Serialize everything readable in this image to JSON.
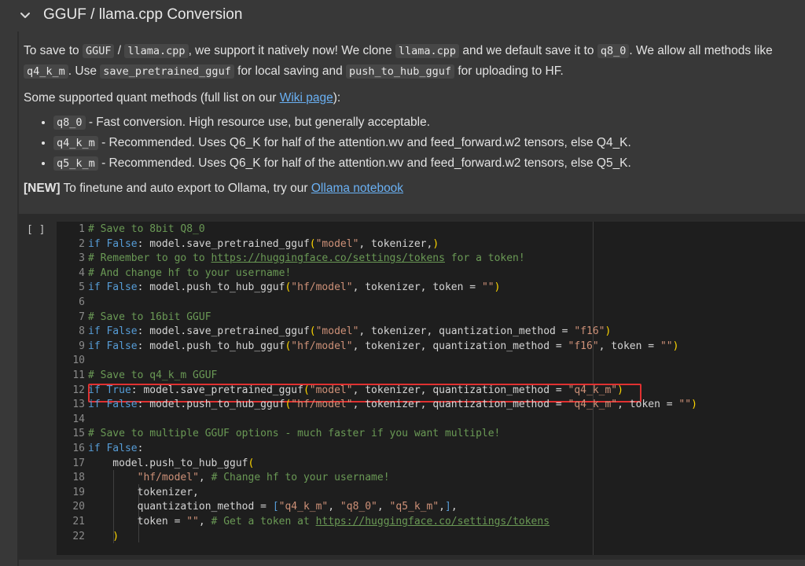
{
  "header": {
    "title": "GGUF / llama.cpp Conversion"
  },
  "intro": {
    "t1": "To save to ",
    "c1": "GGUF",
    "t2": " / ",
    "c2": "llama.cpp",
    "t3": ", we support it natively now! We clone ",
    "c3": "llama.cpp",
    "t4": " and we default save it to ",
    "c4": "q8_0",
    "t5": ". We allow all methods like ",
    "c5": "q4_k_m",
    "t6": ". Use ",
    "c6": "save_pretrained_gguf",
    "t7": " for local saving and ",
    "c7": "push_to_hub_gguf",
    "t8": " for uploading to HF."
  },
  "quant_intro": {
    "before": "Some supported quant methods (full list on our ",
    "link": "Wiki page",
    "after": "):"
  },
  "quant_list": [
    {
      "code": "q8_0",
      "desc": " - Fast conversion. High resource use, but generally acceptable."
    },
    {
      "code": "q4_k_m",
      "desc": " - Recommended. Uses Q6_K for half of the attention.wv and feed_forward.w2 tensors, else Q4_K."
    },
    {
      "code": "q5_k_m",
      "desc": " - Recommended. Uses Q6_K for half of the attention.wv and feed_forward.w2 tensors, else Q5_K."
    }
  ],
  "new_note": {
    "tag": "[NEW]",
    "text": " To finetune and auto export to Ollama, try our ",
    "link": "Ollama notebook"
  },
  "cell": {
    "run_label": "[ ]"
  },
  "code_lines": [
    {
      "n": "1",
      "toks": [
        [
          "c",
          "# Save to 8bit Q8_0"
        ]
      ]
    },
    {
      "n": "2",
      "toks": [
        [
          "k",
          "if"
        ],
        [
          "d",
          " "
        ],
        [
          "k",
          "False"
        ],
        [
          "d",
          ": model.save_pretrained_gguf"
        ],
        [
          "p",
          "("
        ],
        [
          "s",
          "\"model\""
        ],
        [
          "d",
          ", tokenizer,"
        ],
        [
          "p",
          ")"
        ]
      ]
    },
    {
      "n": "3",
      "toks": [
        [
          "c",
          "# Remember to go to "
        ],
        [
          "cu",
          "https://huggingface.co/settings/tokens"
        ],
        [
          "c",
          " for a token!"
        ]
      ]
    },
    {
      "n": "4",
      "toks": [
        [
          "c",
          "# And change hf to your username!"
        ]
      ]
    },
    {
      "n": "5",
      "toks": [
        [
          "k",
          "if"
        ],
        [
          "d",
          " "
        ],
        [
          "k",
          "False"
        ],
        [
          "d",
          ": model.push_to_hub_gguf"
        ],
        [
          "p",
          "("
        ],
        [
          "s",
          "\"hf/model\""
        ],
        [
          "d",
          ", tokenizer, token = "
        ],
        [
          "s",
          "\"\""
        ],
        [
          "p",
          ")"
        ]
      ]
    },
    {
      "n": "6",
      "toks": []
    },
    {
      "n": "7",
      "toks": [
        [
          "c",
          "# Save to 16bit GGUF"
        ]
      ]
    },
    {
      "n": "8",
      "toks": [
        [
          "k",
          "if"
        ],
        [
          "d",
          " "
        ],
        [
          "k",
          "False"
        ],
        [
          "d",
          ": model.save_pretrained_gguf"
        ],
        [
          "p",
          "("
        ],
        [
          "s",
          "\"model\""
        ],
        [
          "d",
          ", tokenizer, quantization_method = "
        ],
        [
          "s",
          "\"f16\""
        ],
        [
          "p",
          ")"
        ]
      ]
    },
    {
      "n": "9",
      "toks": [
        [
          "k",
          "if"
        ],
        [
          "d",
          " "
        ],
        [
          "k",
          "False"
        ],
        [
          "d",
          ": model.push_to_hub_gguf"
        ],
        [
          "p",
          "("
        ],
        [
          "s",
          "\"hf/model\""
        ],
        [
          "d",
          ", tokenizer, quantization_method = "
        ],
        [
          "s",
          "\"f16\""
        ],
        [
          "d",
          ", token = "
        ],
        [
          "s",
          "\"\""
        ],
        [
          "p",
          ")"
        ]
      ]
    },
    {
      "n": "10",
      "toks": []
    },
    {
      "n": "11",
      "toks": [
        [
          "c",
          "# Save to q4_k_m GGUF"
        ]
      ]
    },
    {
      "n": "12",
      "toks": [
        [
          "k",
          "if"
        ],
        [
          "d",
          " "
        ],
        [
          "k",
          "True"
        ],
        [
          "d",
          ": model.save_pretrained_gguf"
        ],
        [
          "p",
          "("
        ],
        [
          "s",
          "\"model\""
        ],
        [
          "d",
          ", tokenizer, quantization_method = "
        ],
        [
          "s",
          "\"q4_k_m\""
        ],
        [
          "p",
          ")"
        ]
      ]
    },
    {
      "n": "13",
      "toks": [
        [
          "k",
          "if"
        ],
        [
          "d",
          " "
        ],
        [
          "k",
          "False"
        ],
        [
          "d",
          ": model.push_to_hub_gguf"
        ],
        [
          "p",
          "("
        ],
        [
          "s",
          "\"hf/model\""
        ],
        [
          "d",
          ", tokenizer, quantization_method = "
        ],
        [
          "s",
          "\"q4_k_m\""
        ],
        [
          "d",
          ", token = "
        ],
        [
          "s",
          "\"\""
        ],
        [
          "p",
          ")"
        ]
      ]
    },
    {
      "n": "14",
      "toks": []
    },
    {
      "n": "15",
      "toks": [
        [
          "c",
          "# Save to multiple GGUF options - much faster if you want multiple!"
        ]
      ]
    },
    {
      "n": "16",
      "toks": [
        [
          "k",
          "if"
        ],
        [
          "d",
          " "
        ],
        [
          "k",
          "False"
        ],
        [
          "d",
          ":"
        ]
      ]
    },
    {
      "n": "17",
      "toks": [
        [
          "d",
          "    model.push_to_hub_gguf"
        ],
        [
          "p",
          "("
        ]
      ]
    },
    {
      "n": "18",
      "toks": [
        [
          "d",
          "        "
        ],
        [
          "s",
          "\"hf/model\""
        ],
        [
          "d",
          ", "
        ],
        [
          "c",
          "# Change hf to your username!"
        ]
      ]
    },
    {
      "n": "19",
      "toks": [
        [
          "d",
          "        tokenizer,"
        ]
      ]
    },
    {
      "n": "20",
      "toks": [
        [
          "d",
          "        quantization_method = "
        ],
        [
          "k",
          "["
        ],
        [
          "s",
          "\"q4_k_m\""
        ],
        [
          "d",
          ", "
        ],
        [
          "s",
          "\"q8_0\""
        ],
        [
          "d",
          ", "
        ],
        [
          "s",
          "\"q5_k_m\""
        ],
        [
          "d",
          ","
        ],
        [
          "k",
          "]"
        ],
        [
          "d",
          ","
        ]
      ]
    },
    {
      "n": "21",
      "toks": [
        [
          "d",
          "        token = "
        ],
        [
          "s",
          "\"\""
        ],
        [
          "d",
          ", "
        ],
        [
          "c",
          "# Get a token at "
        ],
        [
          "cu",
          "https://huggingface.co/settings/tokens"
        ]
      ]
    },
    {
      "n": "22",
      "toks": [
        [
          "p",
          "    )"
        ]
      ]
    }
  ],
  "colors": {
    "comment": "#6a9955",
    "keyword": "#569cd6",
    "string": "#ce9178",
    "paren": "#ffd700",
    "highlight_box": "#e03131",
    "link": "#6ab0f3"
  }
}
